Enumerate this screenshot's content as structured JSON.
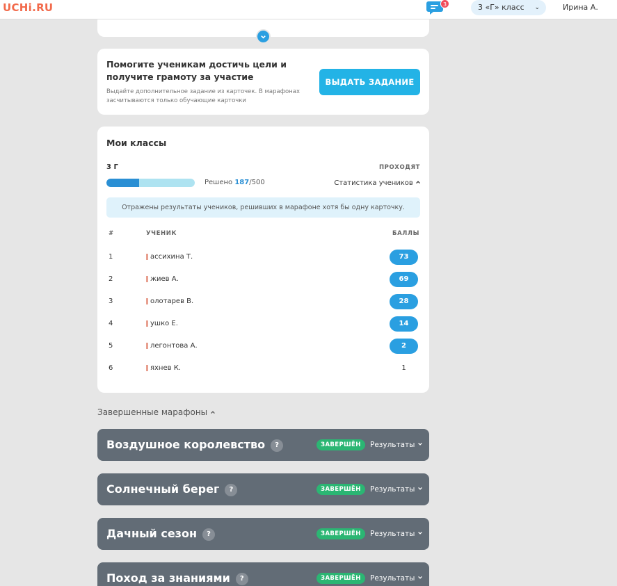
{
  "header": {
    "logo": "UCHi.RU",
    "chat_badge": "3",
    "class_select": "3 «Г» класс",
    "user_name": "Ирина А."
  },
  "help_card": {
    "title": "Помогите ученикам достичь цели и получите грамоту за участие",
    "description": "Выдайте дополнительное задание из карточек. В марафонах засчитываются только обучающие карточки",
    "button": "ВЫДАТЬ ЗАДАНИЕ"
  },
  "classes_card": {
    "title": "Мои классы",
    "class_name": "3 Г",
    "status_label": "ПРОХОДЯТ",
    "progress_fraction": 0.374,
    "solved_prefix": "Решено",
    "solved_value": "187",
    "solved_total": "/500",
    "stats_link": "Статистика учеников",
    "info": "Отражены результаты учеников, решивших в марафоне хотя бы одну карточку.",
    "columns": {
      "index": "#",
      "student": "УЧЕНИК",
      "score": "БАЛЛЫ"
    },
    "rows": [
      {
        "idx": "1",
        "name": "ассихина Т.",
        "score": "73"
      },
      {
        "idx": "2",
        "name": "жиев А.",
        "score": "69"
      },
      {
        "idx": "3",
        "name": "олотарев В.",
        "score": "28"
      },
      {
        "idx": "4",
        "name": "ушко Е.",
        "score": "14"
      },
      {
        "idx": "5",
        "name": "легонтова А.",
        "score": "2"
      },
      {
        "idx": "6",
        "name": "яхнев К.",
        "score": "1"
      }
    ]
  },
  "completed": {
    "title": "Завершенные марафоны",
    "badge": "ЗАВЕРШЁН",
    "results_label": "Результаты",
    "items": [
      {
        "title": "Воздушное королевство"
      },
      {
        "title": "Солнечный берег"
      },
      {
        "title": "Дачный сезон"
      },
      {
        "title": "Поход за знаниями"
      }
    ]
  },
  "colors": {
    "accent": "#2a9fe1",
    "logo": "#f26a4b",
    "completed_badge": "#2bb673",
    "marathon_bg": "#626c76"
  }
}
